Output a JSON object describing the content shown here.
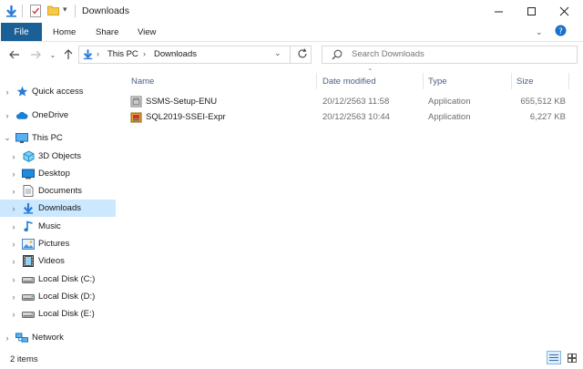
{
  "window": {
    "title": "Downloads"
  },
  "ribbon": {
    "tabs": [
      "File",
      "Home",
      "Share",
      "View"
    ]
  },
  "address": {
    "crumbs": [
      "This PC",
      "Downloads"
    ]
  },
  "search": {
    "placeholder": "Search Downloads"
  },
  "nav": {
    "items": [
      {
        "label": "Quick access"
      },
      {
        "label": "OneDrive"
      },
      {
        "label": "This PC"
      },
      {
        "label": "3D Objects"
      },
      {
        "label": "Desktop"
      },
      {
        "label": "Documents"
      },
      {
        "label": "Downloads"
      },
      {
        "label": "Music"
      },
      {
        "label": "Pictures"
      },
      {
        "label": "Videos"
      },
      {
        "label": "Local Disk (C:)"
      },
      {
        "label": "Local Disk (D:)"
      },
      {
        "label": "Local Disk (E:)"
      },
      {
        "label": "Network"
      }
    ]
  },
  "columns": {
    "name": "Name",
    "date": "Date modified",
    "type": "Type",
    "size": "Size"
  },
  "files": [
    {
      "name": "SSMS-Setup-ENU",
      "date": "20/12/2563 11:58",
      "type": "Application",
      "size": "655,512 KB"
    },
    {
      "name": "SQL2019-SSEI-Expr",
      "date": "20/12/2563 10:44",
      "type": "Application",
      "size": "6,227 KB"
    }
  ],
  "status": {
    "count": "2 items"
  },
  "colors": {
    "accent": "#1a5f95",
    "selected": "#cce8ff",
    "header": "#4d6082"
  }
}
